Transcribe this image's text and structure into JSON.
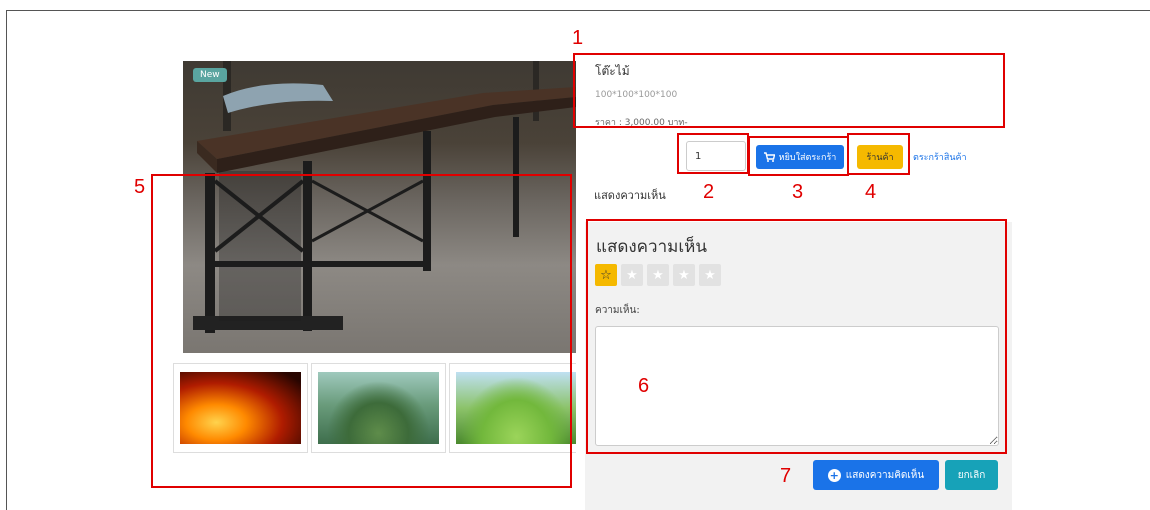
{
  "product": {
    "badge": "New",
    "name": "โต๊ะไม้",
    "size": "100*100*100*100",
    "price": "ราคา : 3,000.00 บาท-"
  },
  "cart": {
    "quantity": "1",
    "add_to_cart_label": "หยิบใส่ตระกร้า",
    "shop_label": "ร้านค้า",
    "basket_link": "ตระกร้าสินค้า",
    "cart_icon": "shopping-cart-icon"
  },
  "comments": {
    "toggle_label": "แสดงความเห็น",
    "title": "แสดงความเห็น",
    "rating": 1,
    "rating_max": 5,
    "field_label": "ความเห็น:",
    "submit_label": "แสดงความคิดเห็น",
    "cancel_label": "ยกเลิก"
  },
  "thumbnails": [
    "fire",
    "forest",
    "meadow"
  ],
  "annotations": [
    "1",
    "2",
    "3",
    "4",
    "5",
    "6",
    "7"
  ],
  "colors": {
    "primary": "#1a73e8",
    "warning": "#f5b900",
    "info": "#17a2b8",
    "annotation": "#e00000"
  }
}
